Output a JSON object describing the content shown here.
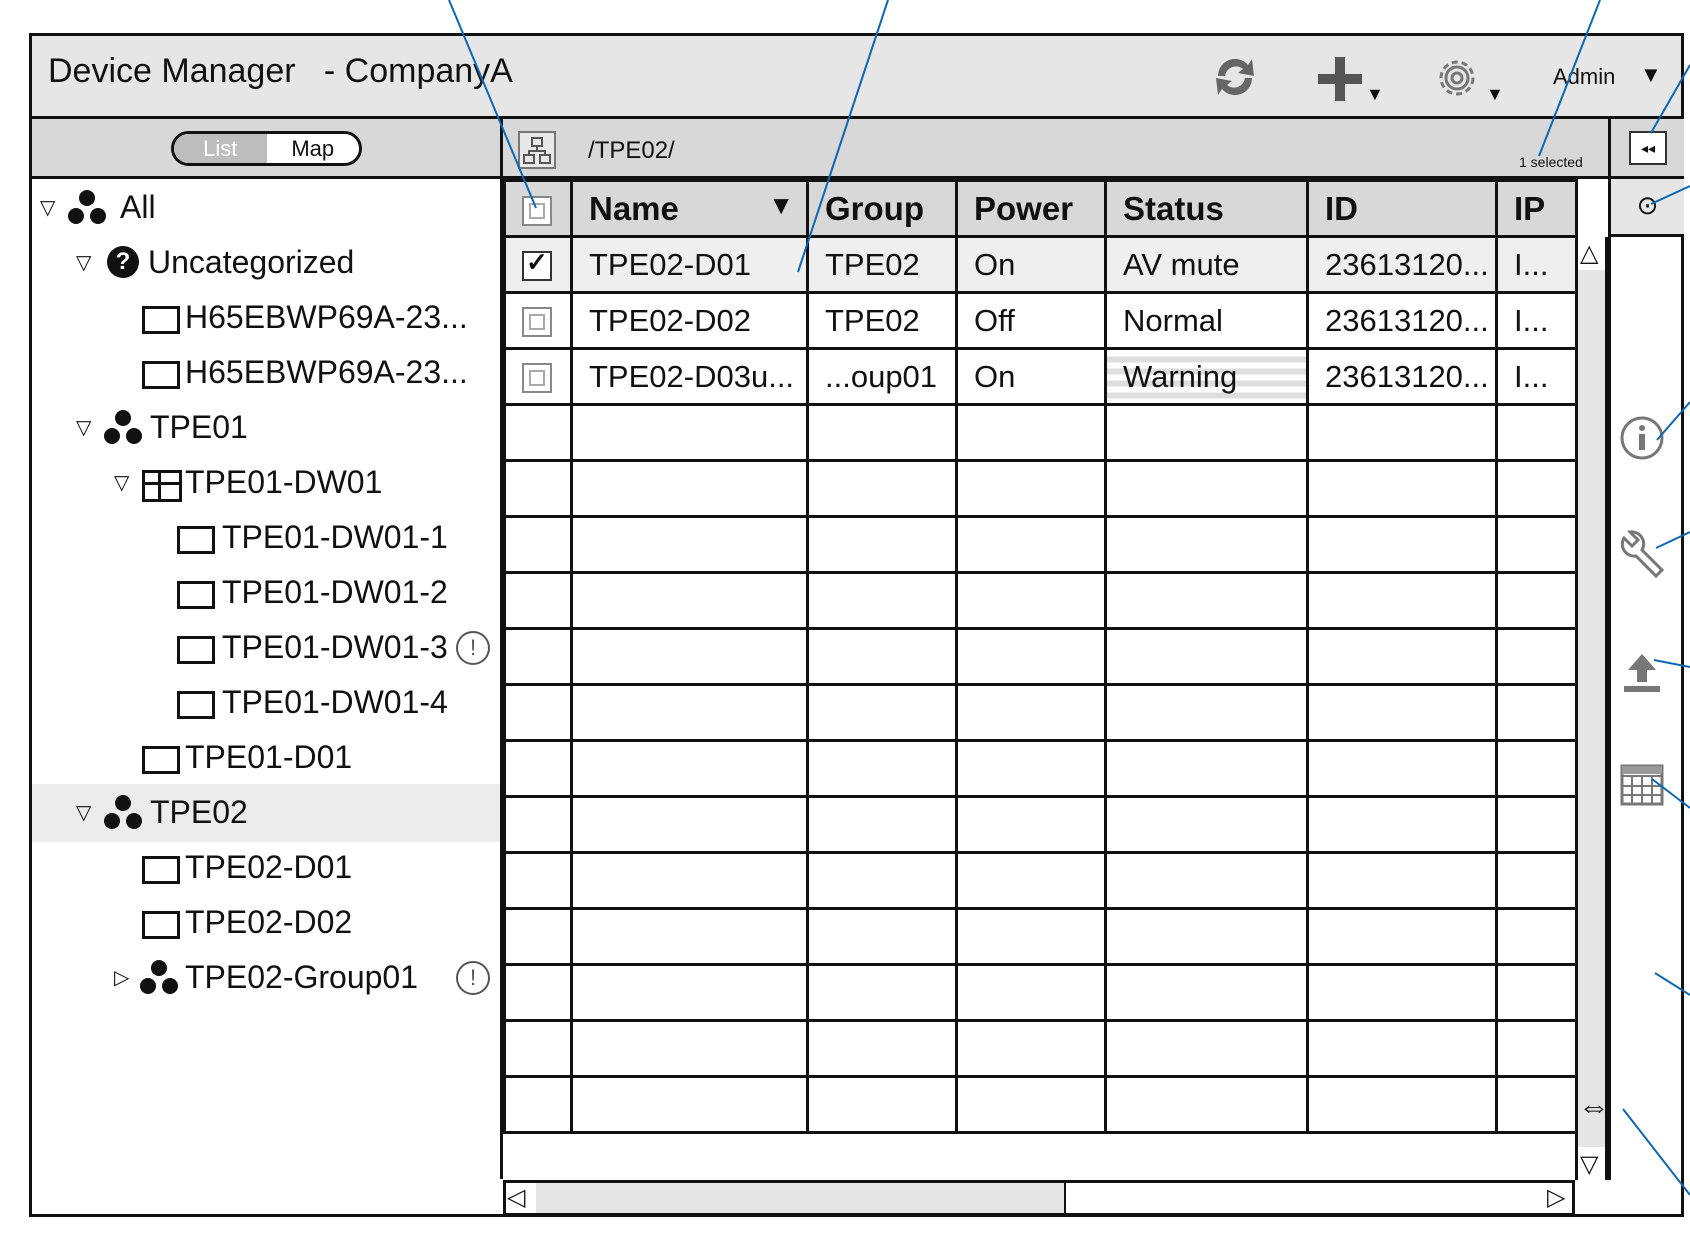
{
  "app": {
    "title": "Device Manager   - CompanyA",
    "user": "Admin"
  },
  "toolbar": {
    "refresh_icon": "refresh-icon",
    "add_icon": "add-icon",
    "settings_icon": "gear-icon"
  },
  "view_toggle": {
    "list_label": "List",
    "map_label": "Map",
    "active": "List"
  },
  "path": {
    "text": "/TPE02/",
    "selected_count": "1 selected"
  },
  "tree": [
    {
      "label": "All",
      "icon": "group-icon",
      "expanded": true
    },
    {
      "label": "Uncategorized",
      "icon": "question-icon",
      "expanded": true
    },
    {
      "label": "H65EBWP69A-23...",
      "icon": "display-icon"
    },
    {
      "label": "H65EBWP69A-23...",
      "icon": "display-icon"
    },
    {
      "label": "TPE01",
      "icon": "group-icon",
      "expanded": true
    },
    {
      "label": "TPE01-DW01",
      "icon": "videowall-icon",
      "expanded": true
    },
    {
      "label": "TPE01-DW01-1",
      "icon": "display-icon"
    },
    {
      "label": "TPE01-DW01-2",
      "icon": "display-icon"
    },
    {
      "label": "TPE01-DW01-3",
      "icon": "display-icon",
      "warning": true
    },
    {
      "label": "TPE01-DW01-4",
      "icon": "display-icon"
    },
    {
      "label": "TPE01-D01",
      "icon": "display-icon"
    },
    {
      "label": "TPE02",
      "icon": "group-icon",
      "expanded": true,
      "selected": true
    },
    {
      "label": "TPE02-D01",
      "icon": "display-icon"
    },
    {
      "label": "TPE02-D02",
      "icon": "display-icon"
    },
    {
      "label": "TPE02-Group01",
      "icon": "group-icon",
      "expanded": false,
      "warning": true
    }
  ],
  "grid": {
    "columns": [
      "Name",
      "Group",
      "Power",
      "Status",
      "ID",
      "IP"
    ],
    "sort_indicator": "▼",
    "rows": [
      {
        "checked": true,
        "name": "TPE02-D01",
        "group": "TPE02",
        "power": "On",
        "status": "AV mute",
        "id": "23613120...",
        "ip": "I..."
      },
      {
        "checked": false,
        "name": "TPE02-D02",
        "group": "TPE02",
        "power": "Off",
        "status": "Normal",
        "id": "23613120...",
        "ip": "I..."
      },
      {
        "checked": false,
        "name": "TPE02-D03u...",
        "group": "...oup01",
        "power": "On",
        "status": "Warning",
        "id": "23613120...",
        "ip": "I..."
      }
    ],
    "empty_rows": 13
  },
  "side_panel": {
    "icons": [
      "info-icon",
      "wrench-icon",
      "upload-icon",
      "calendar-icon"
    ]
  }
}
